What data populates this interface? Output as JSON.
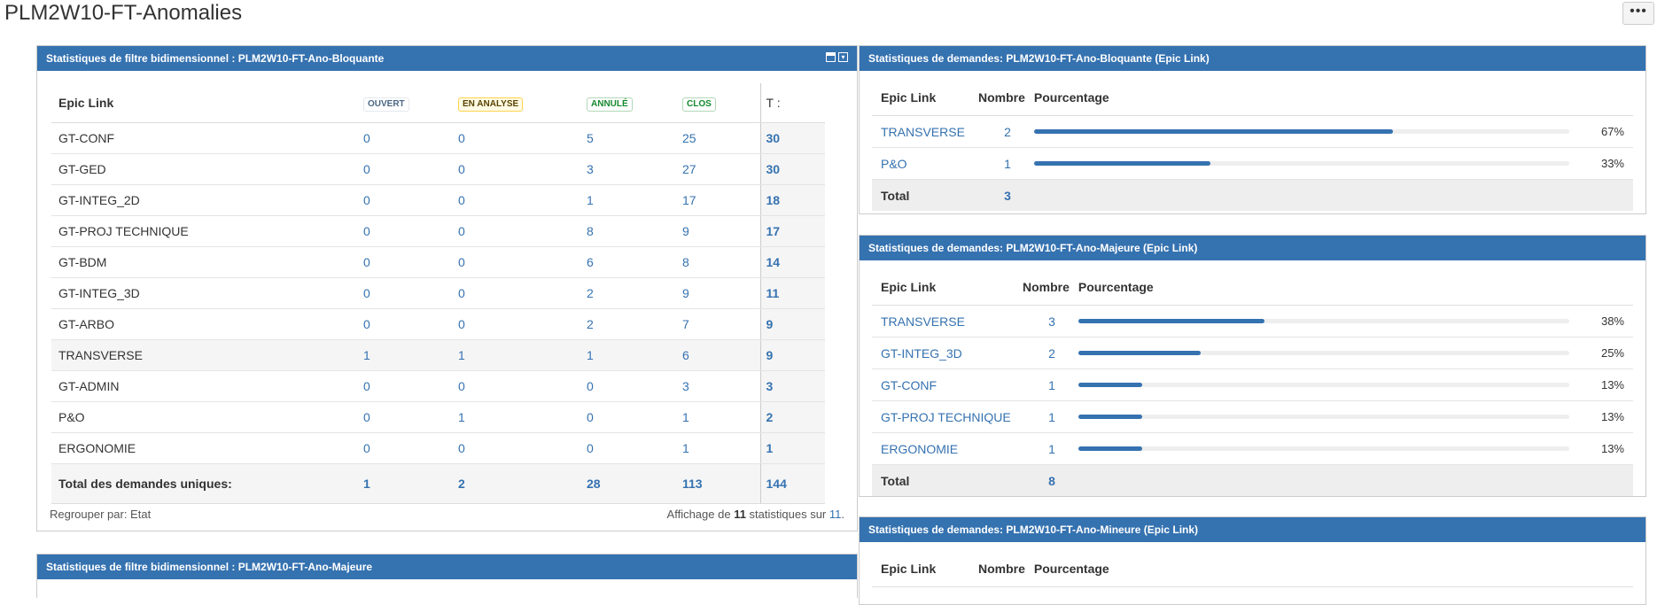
{
  "page": {
    "title": "PLM2W10-FT-Anomalies",
    "more_label": "•••"
  },
  "tdf_gadget": {
    "header": "Statistiques de filtre bidimensionnel : PLM2W10-FT-Ano-Bloquante",
    "col_first": "Epic Link",
    "statuses": [
      "OUVERT",
      "EN ANALYSE",
      "ANNULÉ",
      "CLOS"
    ],
    "total_col": "T :",
    "rows": [
      {
        "name": "GT-CONF",
        "values": [
          "0",
          "0",
          "5",
          "25"
        ],
        "total": "30"
      },
      {
        "name": "GT-GED",
        "values": [
          "0",
          "0",
          "3",
          "27"
        ],
        "total": "30"
      },
      {
        "name": "GT-INTEG_2D",
        "values": [
          "0",
          "0",
          "1",
          "17"
        ],
        "total": "18"
      },
      {
        "name": "GT-PROJ TECHNIQUE",
        "values": [
          "0",
          "0",
          "8",
          "9"
        ],
        "total": "17"
      },
      {
        "name": "GT-BDM",
        "values": [
          "0",
          "0",
          "6",
          "8"
        ],
        "total": "14"
      },
      {
        "name": "GT-INTEG_3D",
        "values": [
          "0",
          "0",
          "2",
          "9"
        ],
        "total": "11"
      },
      {
        "name": "GT-ARBO",
        "values": [
          "0",
          "0",
          "2",
          "7"
        ],
        "total": "9"
      },
      {
        "name": "TRANSVERSE",
        "values": [
          "1",
          "1",
          "1",
          "6"
        ],
        "total": "9"
      },
      {
        "name": "GT-ADMIN",
        "values": [
          "0",
          "0",
          "0",
          "3"
        ],
        "total": "3"
      },
      {
        "name": "P&O",
        "values": [
          "0",
          "1",
          "0",
          "1"
        ],
        "total": "2"
      },
      {
        "name": "ERGONOMIE",
        "values": [
          "0",
          "0",
          "0",
          "1"
        ],
        "total": "1"
      }
    ],
    "footer_label": "Total des demandes uniques:",
    "footer_values": [
      "1",
      "2",
      "28",
      "113"
    ],
    "footer_total": "144",
    "group_by": "Regrouper par: Etat",
    "showing_prefix": "Affichage de ",
    "showing_count": "11",
    "showing_mid": " statistiques sur ",
    "showing_total": "11",
    "showing_suffix": "."
  },
  "tdf_gadget2": {
    "header": "Statistiques de filtre bidimensionnel : PLM2W10-FT-Ano-Majeure"
  },
  "stats_bloquante": {
    "header": "Statistiques de demandes: PLM2W10-FT-Ano-Bloquante (Epic Link)",
    "col_name": "Epic Link",
    "col_count": "Nombre",
    "col_pct": "Pourcentage",
    "rows": [
      {
        "name": "TRANSVERSE",
        "count": "2",
        "percent": "67%",
        "fraction": 0.67
      },
      {
        "name": "P&O",
        "count": "1",
        "percent": "33%",
        "fraction": 0.33
      }
    ],
    "total_label": "Total",
    "total_value": "3"
  },
  "stats_majeure": {
    "header": "Statistiques de demandes: PLM2W10-FT-Ano-Majeure (Epic Link)",
    "col_name": "Epic Link",
    "col_count": "Nombre",
    "col_pct": "Pourcentage",
    "rows": [
      {
        "name": "TRANSVERSE",
        "count": "3",
        "percent": "38%",
        "fraction": 0.38
      },
      {
        "name": "GT-INTEG_3D",
        "count": "2",
        "percent": "25%",
        "fraction": 0.25
      },
      {
        "name": "GT-CONF",
        "count": "1",
        "percent": "13%",
        "fraction": 0.13
      },
      {
        "name": "GT-PROJ TECHNIQUE",
        "count": "1",
        "percent": "13%",
        "fraction": 0.13
      },
      {
        "name": "ERGONOMIE",
        "count": "1",
        "percent": "13%",
        "fraction": 0.13
      }
    ],
    "total_label": "Total",
    "total_value": "8"
  },
  "stats_mineure": {
    "header": "Statistiques de demandes: PLM2W10-FT-Ano-Mineure (Epic Link)",
    "col_name": "Epic Link",
    "col_count": "Nombre",
    "col_pct": "Pourcentage"
  }
}
